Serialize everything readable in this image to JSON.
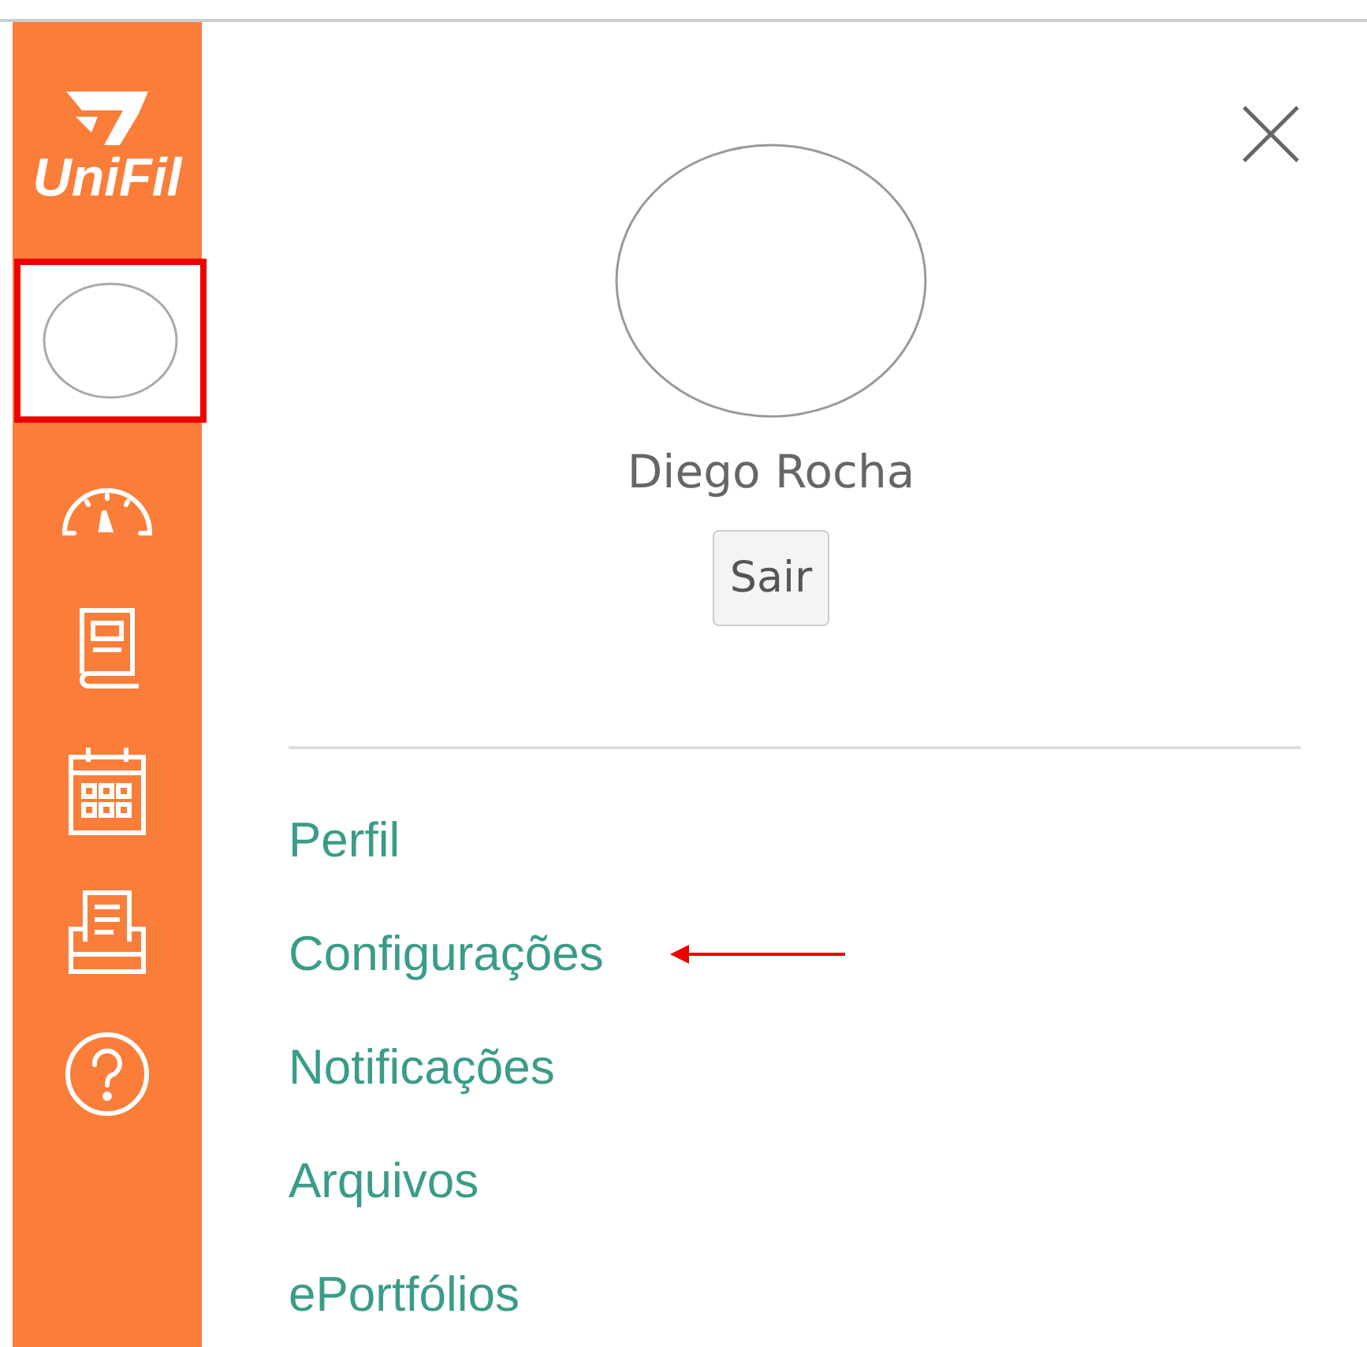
{
  "sidebar": {
    "logo": {
      "text": "UniFil"
    },
    "items": [
      {
        "kind": "avatar",
        "highlighted": true
      },
      {
        "kind": "dashboard",
        "highlighted": false
      },
      {
        "kind": "courses",
        "highlighted": false
      },
      {
        "kind": "calendar",
        "highlighted": false
      },
      {
        "kind": "inbox",
        "highlighted": false
      },
      {
        "kind": "help",
        "highlighted": false
      }
    ]
  },
  "profile": {
    "name": "Diego Rocha",
    "logout_button": "Sair"
  },
  "links": [
    {
      "label": "Perfil",
      "highlighted": false
    },
    {
      "label": "Configurações",
      "highlighted": true
    },
    {
      "label": "Notificações",
      "highlighted": false
    },
    {
      "label": "Arquivos",
      "highlighted": false
    },
    {
      "label": "ePortfólios",
      "highlighted": false
    }
  ]
}
